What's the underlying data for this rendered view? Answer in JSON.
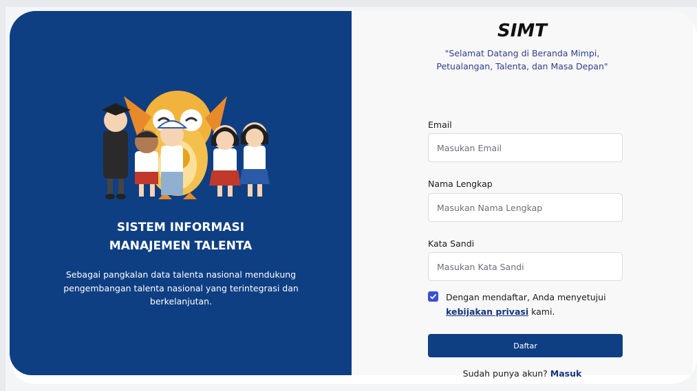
{
  "left": {
    "title_line1": "SISTEM INFORMASI",
    "title_line2": "MANAJEMEN TALENTA",
    "description": "Sebagai pangkalan data talenta nasional mendukung pengembangan talenta nasional yang terintegrasi dan berkelanjutan."
  },
  "right": {
    "app_title": "SIMT",
    "tagline_line1": "\"Selamat Datang di Beranda Mimpi,",
    "tagline_line2": "Petualangan, Talenta, dan Masa Depan\""
  },
  "form": {
    "email": {
      "label": "Email",
      "placeholder": "Masukan Email",
      "value": ""
    },
    "fullname": {
      "label": "Nama Lengkap",
      "placeholder": "Masukan Nama Lengkap",
      "value": ""
    },
    "password": {
      "label": "Kata Sandi",
      "placeholder": "Masukan Kata Sandi",
      "value": ""
    },
    "consent": {
      "checked": true,
      "text_before": "Dengan mendaftar, Anda menyetujui",
      "link_text": "kebijakan privasi",
      "text_after": " kami."
    },
    "submit_label": "Daftar",
    "login_prompt": "Sudah punya akun?",
    "login_link": "Masuk"
  },
  "colors": {
    "primary": "#0f3f83",
    "checkbox": "#3b4fd4",
    "tagline": "#2f3f88"
  },
  "icons": {
    "checkbox": "check-icon",
    "illustration": "students-owl-mascot-illustration"
  }
}
